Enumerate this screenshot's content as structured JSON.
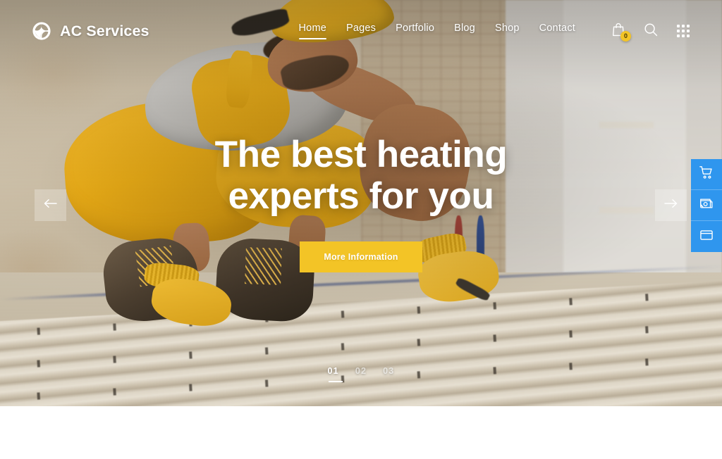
{
  "site": {
    "brand_name": "AC Services",
    "brand_icon": "spiral-swirl-logo-icon",
    "accent_yellow": "#f3c426",
    "accent_blue": "#2f96ee"
  },
  "header": {
    "nav_items": [
      {
        "label": "Home",
        "active": true
      },
      {
        "label": "Pages",
        "active": false
      },
      {
        "label": "Portfolio",
        "active": false
      },
      {
        "label": "Blog",
        "active": false
      },
      {
        "label": "Shop",
        "active": false
      },
      {
        "label": "Contact",
        "active": false
      }
    ],
    "actions": [
      {
        "name": "shopping-bag-icon",
        "badge": "0"
      },
      {
        "name": "search-icon",
        "badge": null
      },
      {
        "name": "grid-menu-icon",
        "badge": null
      }
    ]
  },
  "hero": {
    "title_line_1": "The best heating",
    "title_line_2": "experts for you",
    "cta_label": "More Information",
    "prev_arrow_icon": "arrow-left-icon",
    "next_arrow_icon": "arrow-right-icon",
    "slides": [
      {
        "label": "01",
        "active": true
      },
      {
        "label": "02",
        "active": false
      },
      {
        "label": "03",
        "active": false
      }
    ]
  },
  "side_panel": {
    "buttons": [
      {
        "name": "cart-icon"
      },
      {
        "name": "layers-images-icon"
      },
      {
        "name": "browser-window-icon"
      }
    ]
  }
}
